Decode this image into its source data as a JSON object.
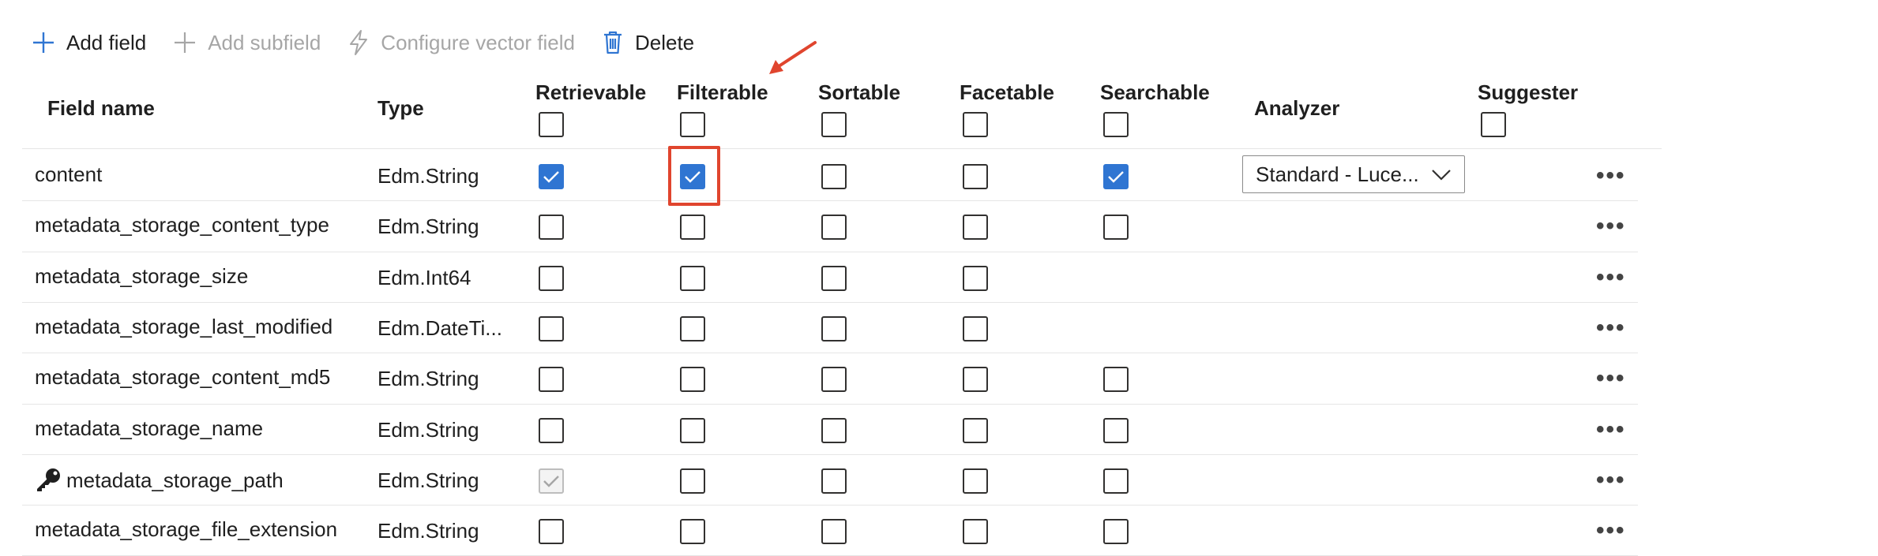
{
  "toolbar": {
    "add_field": "Add field",
    "add_subfield": "Add subfield",
    "configure_vector": "Configure vector field",
    "delete": "Delete"
  },
  "columns": {
    "field_name": "Field name",
    "type": "Type",
    "retrievable": "Retrievable",
    "filterable": "Filterable",
    "sortable": "Sortable",
    "facetable": "Facetable",
    "searchable": "Searchable",
    "analyzer": "Analyzer",
    "suggester": "Suggester"
  },
  "analyzer_value": "Standard - Luce...",
  "more_label": "•••",
  "rows": [
    {
      "name": "content",
      "type": "Edm.String",
      "retrievable": "checked",
      "filterable": "checked",
      "sortable": "unchecked",
      "facetable": "unchecked",
      "searchable": "checked",
      "key": false
    },
    {
      "name": "metadata_storage_content_type",
      "type": "Edm.String",
      "retrievable": "unchecked",
      "filterable": "unchecked",
      "sortable": "unchecked",
      "facetable": "unchecked",
      "searchable": "unchecked",
      "key": false
    },
    {
      "name": "metadata_storage_size",
      "type": "Edm.Int64",
      "retrievable": "unchecked",
      "filterable": "unchecked",
      "sortable": "unchecked",
      "facetable": "unchecked",
      "searchable": "none",
      "key": false
    },
    {
      "name": "metadata_storage_last_modified",
      "type": "Edm.DateTi...",
      "retrievable": "unchecked",
      "filterable": "unchecked",
      "sortable": "unchecked",
      "facetable": "unchecked",
      "searchable": "none",
      "key": false
    },
    {
      "name": "metadata_storage_content_md5",
      "type": "Edm.String",
      "retrievable": "unchecked",
      "filterable": "unchecked",
      "sortable": "unchecked",
      "facetable": "unchecked",
      "searchable": "unchecked",
      "key": false
    },
    {
      "name": "metadata_storage_name",
      "type": "Edm.String",
      "retrievable": "unchecked",
      "filterable": "unchecked",
      "sortable": "unchecked",
      "facetable": "unchecked",
      "searchable": "unchecked",
      "key": false
    },
    {
      "name": "metadata_storage_path",
      "type": "Edm.String",
      "retrievable": "disabled-checked",
      "filterable": "unchecked",
      "sortable": "unchecked",
      "facetable": "unchecked",
      "searchable": "unchecked",
      "key": true
    },
    {
      "name": "metadata_storage_file_extension",
      "type": "Edm.String",
      "retrievable": "unchecked",
      "filterable": "unchecked",
      "sortable": "unchecked",
      "facetable": "unchecked",
      "searchable": "unchecked",
      "key": false
    }
  ],
  "colors": {
    "accent": "#2f75d2",
    "annotation": "#e0452e"
  },
  "icons": [
    "plus-icon",
    "bolt-icon",
    "trash-icon",
    "key-icon",
    "chevron-down-icon",
    "checkmark-icon",
    "ellipsis-icon",
    "annotation-arrow"
  ]
}
